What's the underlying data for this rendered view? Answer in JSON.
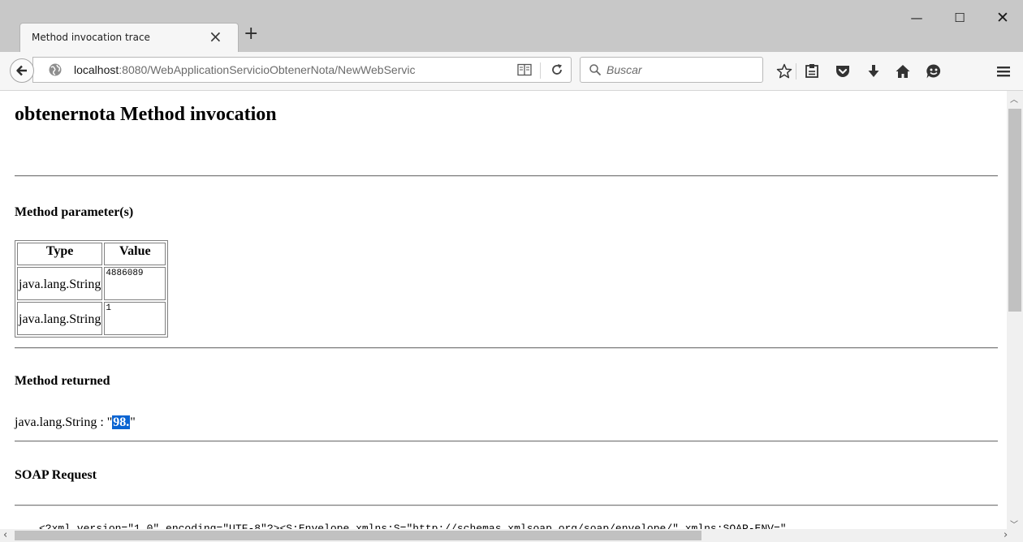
{
  "browser": {
    "tab_title": "Method invocation trace",
    "tab_close": "×",
    "new_tab": "+",
    "window_controls": {
      "minimize": "—",
      "maximize": "☐",
      "close": "✕"
    },
    "url_host": "localhost",
    "url_rest": ":8080/WebApplicationServicioObtenerNota/NewWebServic",
    "search_placeholder": "Buscar",
    "toolbar_icons": [
      "back-icon",
      "globe-icon",
      "reader-view-icon",
      "reload-icon",
      "search-icon",
      "bookmark-star-icon",
      "bookmarks-library-icon",
      "pocket-icon",
      "downloads-icon",
      "home-icon",
      "hello-icon",
      "menu-icon"
    ]
  },
  "page": {
    "title": "obtenernota Method invocation",
    "params_heading": "Method parameter(s)",
    "table_headers": [
      "Type",
      "Value"
    ],
    "params": [
      {
        "type": "java.lang.String",
        "value": "4886089"
      },
      {
        "type": "java.lang.String",
        "value": "1"
      }
    ],
    "returned_heading": "Method returned",
    "returned_prefix": "java.lang.String : \"",
    "returned_value": "98.",
    "returned_suffix": "\"",
    "soap_request_heading": "SOAP Request",
    "soap_request_line": "<?xml version=\"1.0\" encoding=\"UTF-8\"?><S:Envelope xmlns:S=\"http://schemas.xmlsoap.org/soap/envelope/\" xmlns:SOAP-ENV=\""
  },
  "colors": {
    "selection": "#0a64d2",
    "chrome": "#c8c8c8",
    "toolbar": "#f6f6f6"
  }
}
